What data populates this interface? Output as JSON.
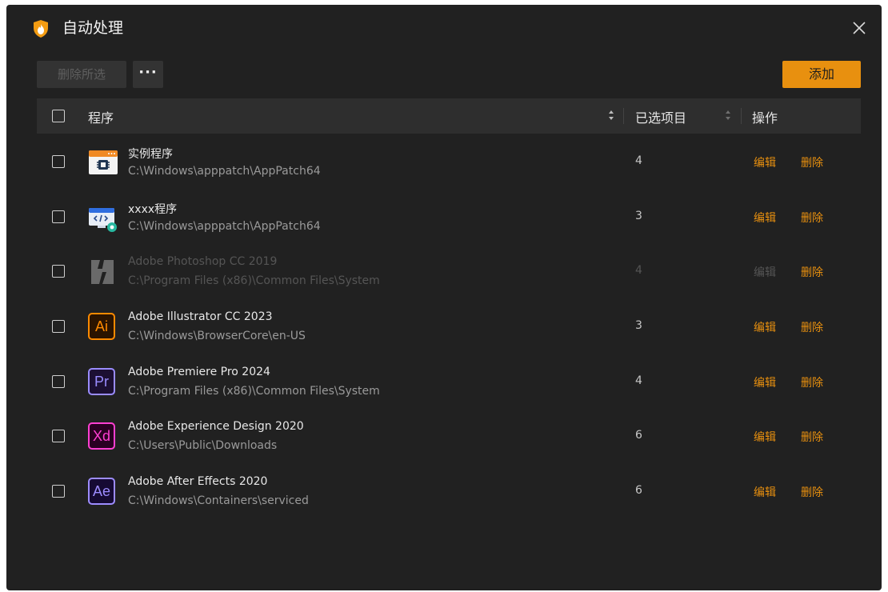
{
  "window": {
    "title": "自动处理",
    "background": "#212121",
    "accent": "#e8900f"
  },
  "icons": {
    "app_logo": "shield-flame-icon",
    "close": "close-icon",
    "more": "more-dots-icon",
    "sort": "sort-icon"
  },
  "toolbar": {
    "delete_selected_label": "删除所选",
    "more_label": "···",
    "add_label": "添加"
  },
  "table": {
    "columns": {
      "program": "程序",
      "selected_items": "已选项目",
      "actions": "操作"
    },
    "rows": [
      {
        "name": "实例程序",
        "path": "C:\\Windows\\apppatch\\AppPatch64",
        "count": "4",
        "edit": "编辑",
        "delete": "删除",
        "icon": "app-window-icon",
        "disabled": false
      },
      {
        "name": "xxxx程序",
        "path": "C:\\Windows\\apppatch\\AppPatch64",
        "count": "3",
        "edit": "编辑",
        "delete": "删除",
        "icon": "code-settings-icon",
        "disabled": false
      },
      {
        "name": "Adobe Photoshop CC 2019",
        "path": "C:\\Program Files (x86)\\Common Files\\System",
        "count": "4",
        "edit": "编辑",
        "delete": "删除",
        "icon": "broken-file-icon",
        "disabled": true
      },
      {
        "name": "Adobe Illustrator CC 2023",
        "path": "C:\\Windows\\BrowserCore\\en-US",
        "count": "3",
        "edit": "编辑",
        "delete": "删除",
        "icon": "illustrator-icon",
        "badge": "Ai",
        "badge_color": "#ff8a00",
        "badge_bg": "#2b1400",
        "disabled": false
      },
      {
        "name": "Adobe Premiere Pro 2024",
        "path": "C:\\Program Files (x86)\\Common Files\\System",
        "count": "4",
        "edit": "编辑",
        "delete": "删除",
        "icon": "premiere-icon",
        "badge": "Pr",
        "badge_color": "#9a8cff",
        "badge_bg": "#1c0f33",
        "disabled": false
      },
      {
        "name": "Adobe Experience Design 2020",
        "path": "C:\\Users\\Public\\Downloads",
        "count": "6",
        "edit": "编辑",
        "delete": "删除",
        "icon": "xd-icon",
        "badge": "Xd",
        "badge_color": "#ff3fd2",
        "badge_bg": "#2a0022",
        "disabled": false
      },
      {
        "name": "Adobe After Effects 2020",
        "path": "C:\\Windows\\Containers\\serviced",
        "count": "6",
        "edit": "编辑",
        "delete": "删除",
        "icon": "after-effects-icon",
        "badge": "Ae",
        "badge_color": "#9d8cff",
        "badge_bg": "#160a33",
        "disabled": false
      }
    ]
  }
}
